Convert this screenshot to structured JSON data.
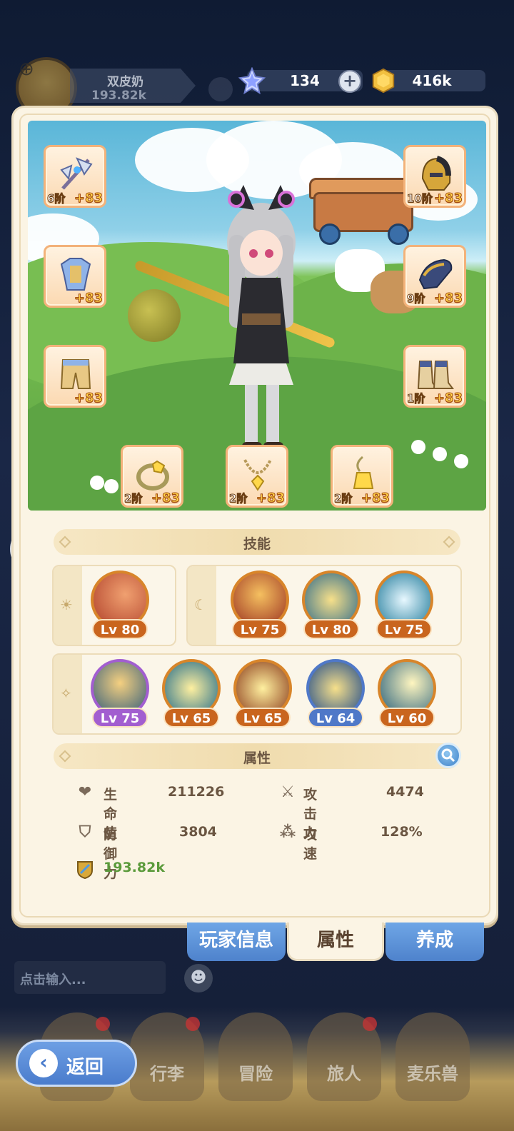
{
  "header": {
    "player_name": "双皮奶",
    "player_power": "193.82k",
    "gems": "134",
    "coins": "416k"
  },
  "equipment": {
    "slots": [
      {
        "name": "weapon",
        "tier": "6阶",
        "bonus": "+83"
      },
      {
        "name": "helmet",
        "tier": "10阶",
        "bonus": "+83"
      },
      {
        "name": "armor",
        "tier": "",
        "bonus": "+83"
      },
      {
        "name": "gloves",
        "tier": "9阶",
        "bonus": "+83"
      },
      {
        "name": "pants",
        "tier": "",
        "bonus": "+83"
      },
      {
        "name": "boots",
        "tier": "1阶",
        "bonus": "+83"
      },
      {
        "name": "ring",
        "tier": "2阶",
        "bonus": "+83"
      },
      {
        "name": "necklace",
        "tier": "2阶",
        "bonus": "+83"
      },
      {
        "name": "amulet",
        "tier": "2阶",
        "bonus": "+83"
      }
    ]
  },
  "skills": {
    "title": "技能",
    "group1": [
      {
        "level": "Lv 80"
      }
    ],
    "group2": [
      {
        "level": "Lv 75"
      },
      {
        "level": "Lv 80"
      },
      {
        "level": "Lv 75"
      }
    ],
    "group3": [
      {
        "level": "Lv 75"
      },
      {
        "level": "Lv 65"
      },
      {
        "level": "Lv 65"
      },
      {
        "level": "Lv 64"
      },
      {
        "level": "Lv 60"
      }
    ]
  },
  "attributes": {
    "title": "属性",
    "hp_label": "生命值",
    "hp_value": "211226",
    "atk_label": "攻击力",
    "atk_value": "4474",
    "def_label": "防御力",
    "def_value": "3804",
    "spd_label": "攻速",
    "spd_value": "128%",
    "power_value": "193.82k"
  },
  "tabs": {
    "player_info": "玩家信息",
    "attributes": "属性",
    "cultivate": "养成"
  },
  "chat": {
    "placeholder": "点击输入..."
  },
  "nav": {
    "back": "返回",
    "luggage": "行李",
    "adventure": "冒险",
    "traveler": "旅人",
    "pets": "麦乐兽"
  },
  "colors": {
    "panel_bg": "#fbf4e4",
    "accent_blue": "#4e82cc",
    "skill_orange": "#c9651e",
    "skill_purple": "#a25ed0",
    "skill_blue": "#4f78c8"
  }
}
